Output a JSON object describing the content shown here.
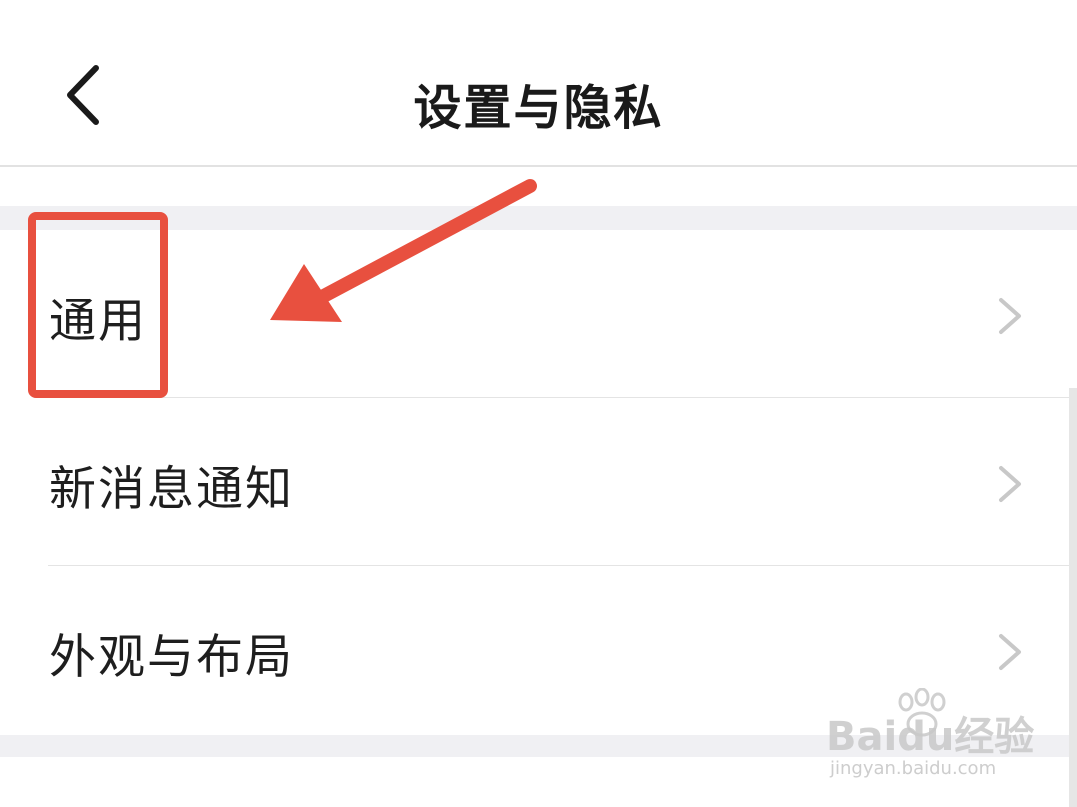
{
  "header": {
    "title": "设置与隐私",
    "back_icon": "chevron-left-icon"
  },
  "settings": {
    "items": [
      {
        "label": "通用",
        "icon": "chevron-right-icon"
      },
      {
        "label": "新消息通知",
        "icon": "chevron-right-icon"
      },
      {
        "label": "外观与布局",
        "icon": "chevron-right-icon"
      }
    ]
  },
  "annotation": {
    "color": "#e8503f",
    "highlighted_item": "通用"
  },
  "watermark": {
    "logo_text": "Baidu经验",
    "url": "jingyan.baidu.com"
  },
  "colors": {
    "background": "#ffffff",
    "separator": "#f0f0f3",
    "text": "#1e1e1e",
    "chevron": "#c8c8c8"
  }
}
